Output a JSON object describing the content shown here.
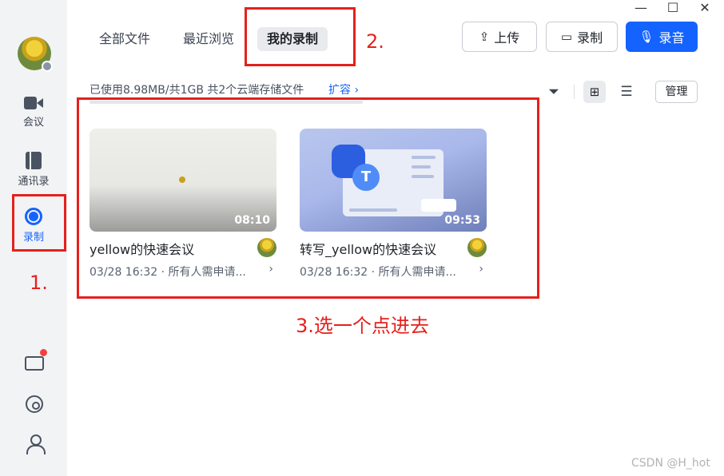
{
  "window": {
    "minimize": "—",
    "maximize": "☐",
    "close": "✕"
  },
  "sidebar": {
    "items": [
      {
        "label": "会议",
        "icon": "video-camera-icon"
      },
      {
        "label": "通讯录",
        "icon": "address-book-icon"
      },
      {
        "label": "录制",
        "icon": "record-icon",
        "active": true
      }
    ],
    "bottom_icons": [
      "mail-icon",
      "settings-icon",
      "user-switch-icon"
    ]
  },
  "tabs": [
    {
      "label": "全部文件"
    },
    {
      "label": "最近浏览"
    },
    {
      "label": "我的录制",
      "active": true
    }
  ],
  "toolbar": {
    "upload_label": "上传",
    "record_label": "录制",
    "audio_label": "录音",
    "manage_label": "管理"
  },
  "storage": {
    "text": "已使用8.98MB/共1GB   共2个云端存储文件",
    "expand_label": "扩容 ›"
  },
  "cards": [
    {
      "title": "yellow的快速会议",
      "duration": "08:10",
      "meta": "03/28 16:32 · 所有人需申请...",
      "chevron": "›"
    },
    {
      "title": "转写_yellow的快速会议",
      "duration": "09:53",
      "meta": "03/28 16:32 · 所有人需申请...",
      "chevron": "›"
    }
  ],
  "annotations": {
    "step1": "1.",
    "step2": "2.",
    "step3": "3.选一个点进去"
  },
  "watermark": "CSDN @H_hot",
  "colors": {
    "accent": "#1463ff",
    "annotation": "#e5201c",
    "sidebar_bg": "#f2f3f5"
  }
}
